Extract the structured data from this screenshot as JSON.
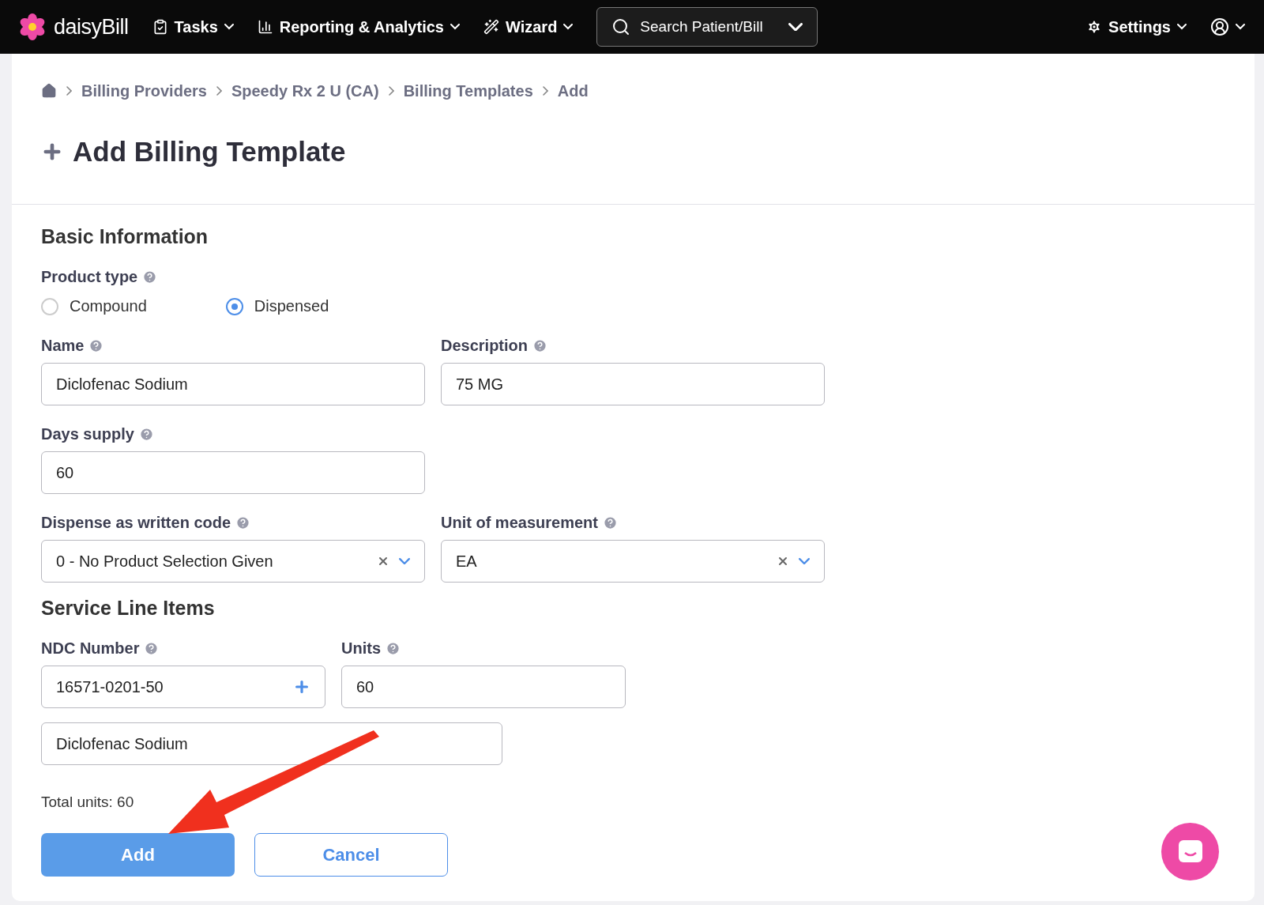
{
  "navbar": {
    "brand": "daisyBill",
    "menus": [
      {
        "label": "Tasks",
        "kind": "tasks"
      },
      {
        "label": "Reporting & Analytics",
        "kind": "reporting"
      },
      {
        "label": "Wizard",
        "kind": "wizard"
      }
    ],
    "search": {
      "placeholder": "Search Patient/Bill"
    },
    "settings": {
      "label": "Settings"
    }
  },
  "breadcrumb": [
    "Billing Providers",
    "Speedy Rx 2 U (CA)",
    "Billing Templates",
    "Add"
  ],
  "page_title": "Add Billing Template",
  "basic_information": {
    "heading": "Basic Information",
    "product_type": {
      "label": "Product type",
      "options": [
        {
          "label": "Compound",
          "selected": false
        },
        {
          "label": "Dispensed",
          "selected": true
        }
      ]
    },
    "name": {
      "label": "Name",
      "value": "Diclofenac Sodium"
    },
    "description": {
      "label": "Description",
      "value": "75 MG"
    },
    "days_supply": {
      "label": "Days supply",
      "value": "60"
    },
    "dispense_as_written_code": {
      "label": "Dispense as written code",
      "value": "0 - No Product Selection Given"
    },
    "unit_of_measurement": {
      "label": "Unit of measurement",
      "value": "EA"
    }
  },
  "service_line_items": {
    "heading": "Service Line Items",
    "ndc_number": {
      "label": "NDC Number",
      "value": "16571-0201-50"
    },
    "units": {
      "label": "Units",
      "value": "60"
    },
    "drug_name": {
      "value": "Diclofenac Sodium"
    },
    "total_units": "Total units: 60"
  },
  "buttons": [
    {
      "label": "Add",
      "kind": "primary"
    },
    {
      "label": "Cancel",
      "kind": "secondary"
    }
  ]
}
